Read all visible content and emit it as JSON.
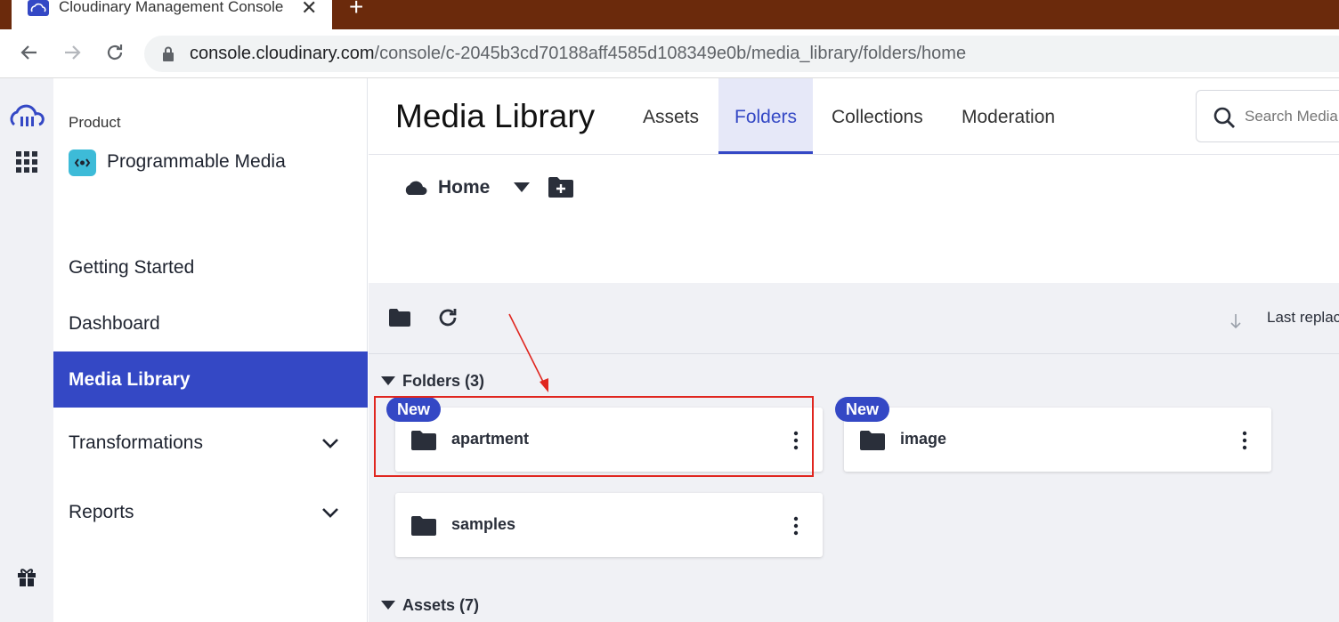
{
  "browser": {
    "tab_title": "Cloudinary Management Console",
    "url_host": "console.cloudinary.com",
    "url_path": "/console/c-2045b3cd70188aff4585d108349e0b/media_library/folders/home"
  },
  "sidebar": {
    "product_label": "Product",
    "product_name": "Programmable Media",
    "items": [
      {
        "label": "Getting Started"
      },
      {
        "label": "Dashboard"
      },
      {
        "label": "Media Library"
      },
      {
        "label": "Transformations"
      },
      {
        "label": "Reports"
      }
    ]
  },
  "header": {
    "title": "Media Library",
    "tabs": [
      {
        "label": "Assets"
      },
      {
        "label": "Folders"
      },
      {
        "label": "Collections"
      },
      {
        "label": "Moderation"
      }
    ],
    "search_placeholder": "Search Media Library"
  },
  "breadcrumb": {
    "home": "Home"
  },
  "toolbar": {
    "sort_label": "Last replaced"
  },
  "folders_section": {
    "title": "Folders (3)",
    "items": [
      {
        "name": "apartment",
        "badge": "New"
      },
      {
        "name": "image",
        "badge": "New"
      },
      {
        "name": "samples",
        "badge": ""
      }
    ]
  },
  "assets_section": {
    "title": "Assets (7)"
  },
  "colors": {
    "accent": "#3448c5",
    "browser_frame": "#6b2a0c",
    "annotation": "#e0261f"
  }
}
